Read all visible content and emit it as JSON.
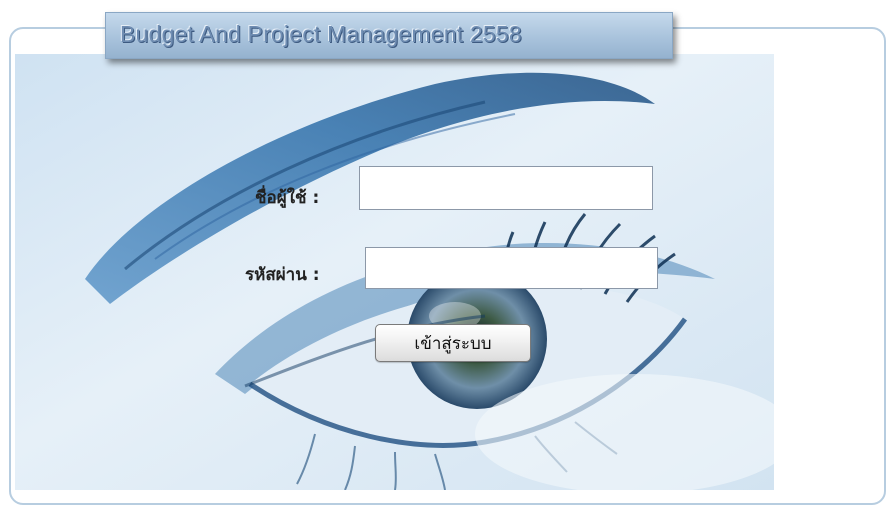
{
  "app": {
    "title": "Budget And Project Management 2558"
  },
  "login": {
    "username_label": "ชื่อผู้ใช้ :",
    "username_value": "",
    "password_label": "รหัสผ่าน :",
    "password_value": "",
    "submit_label": "เข้าสู่ระบบ"
  },
  "background": {
    "image": "eye-icon"
  },
  "colors": {
    "frame_border": "#b7cde0",
    "title_bg": "#a9c3dc",
    "eye_blue": "#3a7fc0"
  }
}
